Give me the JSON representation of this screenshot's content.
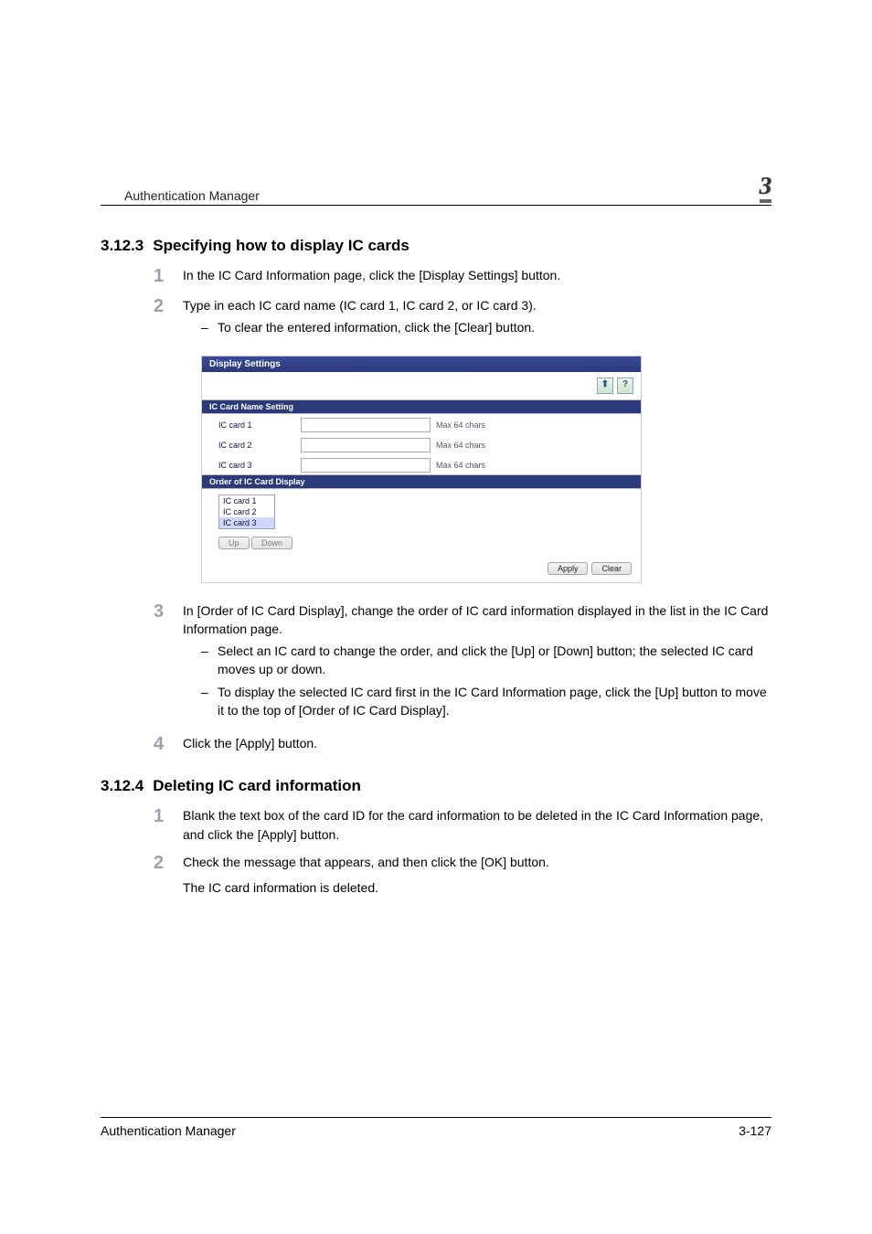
{
  "header": {
    "title": "Authentication Manager",
    "chapter": "3"
  },
  "section1": {
    "number": "3.12.3",
    "title": "Specifying how to display IC cards",
    "steps": {
      "s1": "In the IC Card Information page, click the [Display Settings] button.",
      "s2": {
        "text": "Type in each IC card name (IC card 1, IC card 2, or IC card 3).",
        "sub1": "To clear the entered information, click the [Clear] button."
      },
      "s3": {
        "text": "In [Order of IC Card Display], change the order of IC card information displayed in the list in the IC Card Information page.",
        "sub1": "Select an IC card to change the order, and click the [Up] or [Down] button; the selected IC card moves up or down.",
        "sub2": "To display the selected IC card first in the IC Card Information page, click the [Up] button to move it to the top of [Order of IC Card Display]."
      },
      "s4": "Click the [Apply] button."
    }
  },
  "shot": {
    "title": "Display Settings",
    "back_icon": "⬆",
    "help_icon": "?",
    "section_name": "IC Card Name Setting",
    "rows": {
      "r1": {
        "label": "IC card 1",
        "hint": "Max 64 chars"
      },
      "r2": {
        "label": "IC card 2",
        "hint": "Max 64 chars"
      },
      "r3": {
        "label": "IC card 3",
        "hint": "Max 64 chars"
      }
    },
    "order_section": "Order of IC Card Display",
    "order_opts": {
      "o1": "IC card 1",
      "o2": "IC card 2",
      "o3": "IC card 3"
    },
    "up": "Up",
    "down": "Down",
    "apply": "Apply",
    "clear": "Clear"
  },
  "section2": {
    "number": "3.12.4",
    "title": "Deleting IC card information",
    "steps": {
      "s1": "Blank the text box of the card ID for the card information to be deleted in the IC Card Information page, and click the [Apply] button.",
      "s2": {
        "text": "Check the message that appears, and then click the [OK] button.",
        "after": "The IC card information is deleted."
      }
    }
  },
  "footer": {
    "left": "Authentication Manager",
    "right": "3-127"
  }
}
